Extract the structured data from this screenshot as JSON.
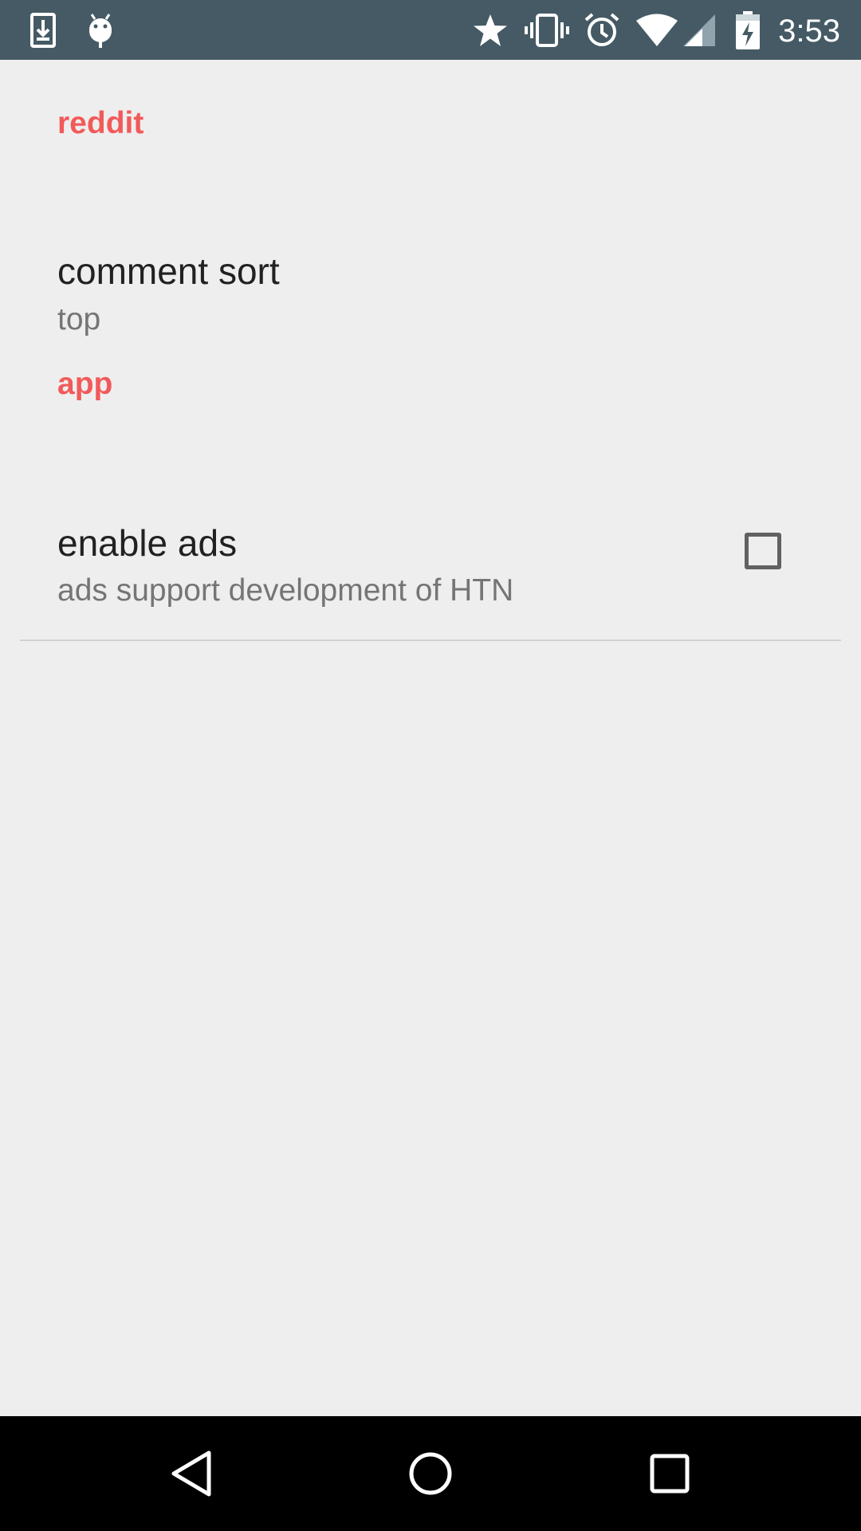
{
  "status_bar": {
    "time": "3:53",
    "background_color": "#455a64",
    "left_icons": [
      "download-icon",
      "android-debug-icon"
    ],
    "right_icons": [
      "star-icon",
      "vibrate-icon",
      "alarm-icon",
      "wifi-icon",
      "cell-signal-icon",
      "battery-charging-icon"
    ]
  },
  "settings": {
    "accent_color": "#f25a5a",
    "categories": [
      {
        "title": "reddit",
        "preferences": [
          {
            "title": "comment sort",
            "summary": "top"
          }
        ]
      },
      {
        "title": "app",
        "preferences": [
          {
            "title": "enable ads",
            "summary": "ads support development of HTN",
            "checked": false
          }
        ]
      }
    ]
  },
  "nav_bar": {
    "buttons": [
      "back-icon",
      "home-icon",
      "recents-icon"
    ]
  }
}
